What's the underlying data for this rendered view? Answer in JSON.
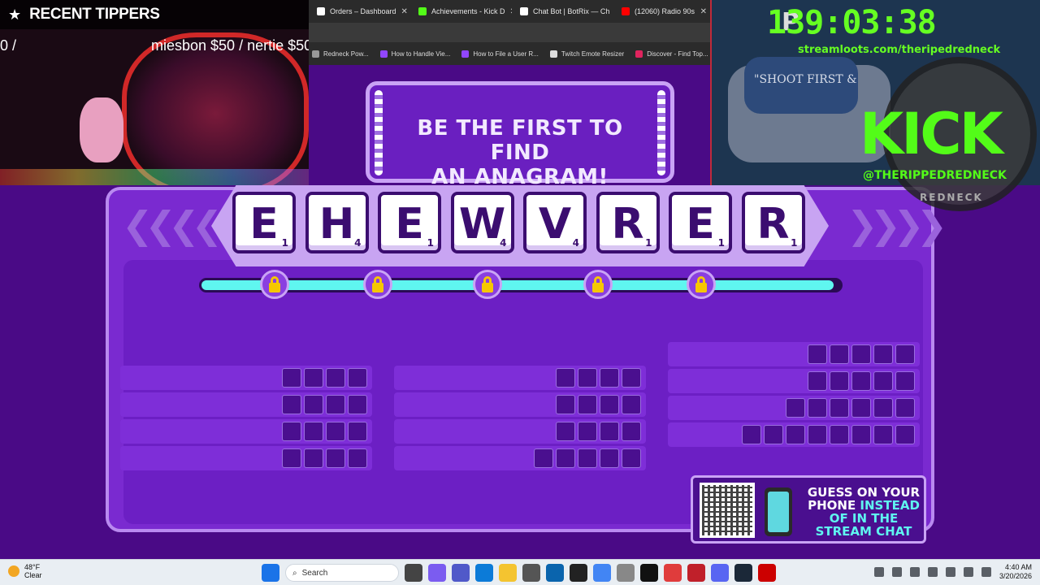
{
  "browser": {
    "tabs": [
      {
        "label": "Orders – Dashboard",
        "color": "#ffffff",
        "active": false
      },
      {
        "label": "Achievements - Kick D",
        "color": "#53fc18",
        "active": false
      },
      {
        "label": "Chat Bot | BotRix — Ch",
        "color": "#ffffff",
        "active": false
      },
      {
        "label": "(12060) Radio 90s",
        "color": "#ff0000",
        "active": false
      }
    ],
    "bookmarks": [
      {
        "label": "Redneck Pow...",
        "color": "#999999"
      },
      {
        "label": "How to Handle Vie...",
        "color": "#9146ff"
      },
      {
        "label": "How to File a User R...",
        "color": "#9146ff"
      },
      {
        "label": "Twitch Emote Resizer",
        "color": "#dddddd"
      },
      {
        "label": "Discover - Find Top...",
        "color": "#e0245e"
      }
    ]
  },
  "game": {
    "title_line1": "BE THE FIRST TO FIND",
    "title_line2": "AN ANAGRAM!",
    "letters": [
      {
        "letter": "E",
        "points": "1"
      },
      {
        "letter": "H",
        "points": "4"
      },
      {
        "letter": "E",
        "points": "1"
      },
      {
        "letter": "W",
        "points": "4"
      },
      {
        "letter": "V",
        "points": "4"
      },
      {
        "letter": "R",
        "points": "1"
      },
      {
        "letter": "E",
        "points": "1"
      },
      {
        "letter": "R",
        "points": "1"
      }
    ],
    "progress_fraction": 0.99,
    "lock_count": 5,
    "word_columns": [
      {
        "word_lengths": [
          4,
          4,
          4,
          4
        ]
      },
      {
        "word_lengths": [
          4,
          4,
          4,
          5
        ]
      },
      {
        "word_lengths": [
          5,
          5,
          6,
          8
        ]
      }
    ],
    "cta": {
      "line1": "GUESS ON YOUR",
      "line2a": "PHONE ",
      "line2b": "INSTEAD",
      "line3": "OF IN THE",
      "line4": "STREAM CHAT"
    }
  },
  "overlay": {
    "tippers_title": "RECENT TIPPERS",
    "tippers_left": "0 /",
    "tippers_right": "miesbon $50 / nertie $50",
    "timer_prefix": "P",
    "timer": "139:03:38",
    "loot_url": "streamloots.com/theripedredneck",
    "kick_logo": "KICK",
    "kick_handle": "@THERIPPEDREDNECK",
    "logo_text": "REDNECK",
    "shirt_text": "\"SHOOT FIRST &"
  },
  "taskbar": {
    "weather_temp": "48°F",
    "weather_desc": "Clear",
    "search_placeholder": "Search",
    "time": "4:40 AM",
    "date": "3/20/2026"
  }
}
